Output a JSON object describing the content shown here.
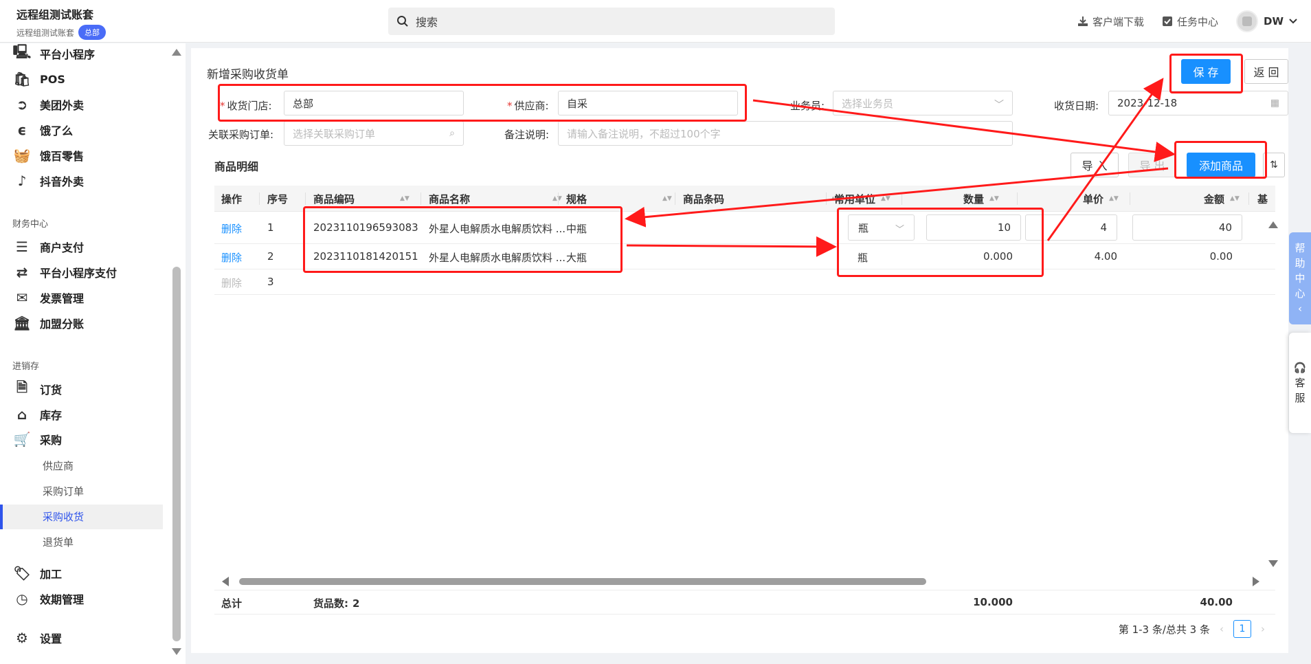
{
  "topbar": {
    "brand_title": "远程组测试账套",
    "brand_sub": "远程组测试账套",
    "brand_badge": "总部",
    "search_placeholder": "搜索",
    "download": "客户端下载",
    "tasks": "任务中心",
    "user": "DW"
  },
  "sidebar": {
    "items_top": [
      {
        "label": "平台小程序",
        "icon": "monitor-icon"
      },
      {
        "label": "POS",
        "icon": "shopping-bag-icon"
      },
      {
        "label": "美团外卖",
        "icon": "meituan-icon"
      },
      {
        "label": "饿了么",
        "icon": "eleme-icon"
      },
      {
        "label": "饿百零售",
        "icon": "basket-icon"
      },
      {
        "label": "抖音外卖",
        "icon": "tiktok-icon"
      }
    ],
    "group_finance": "财务中心",
    "items_finance": [
      {
        "label": "商户支付",
        "icon": "list-icon"
      },
      {
        "label": "平台小程序支付",
        "icon": "transfer-icon"
      },
      {
        "label": "发票管理",
        "icon": "invoice-icon"
      },
      {
        "label": "加盟分账",
        "icon": "bank-icon"
      }
    ],
    "group_inventory": "进销存",
    "items_inventory": [
      {
        "label": "订货",
        "icon": "document-icon"
      },
      {
        "label": "库存",
        "icon": "warehouse-icon"
      },
      {
        "label": "采购",
        "icon": "cart-icon"
      }
    ],
    "purchase_sub": [
      "供应商",
      "采购订单",
      "采购收货",
      "退货单"
    ],
    "items_bottom": [
      {
        "label": "加工",
        "icon": "tag-icon"
      },
      {
        "label": "效期管理",
        "icon": "clock-icon"
      }
    ],
    "settings": "设置"
  },
  "form": {
    "title": "新增采购收货单",
    "save": "保 存",
    "back": "返 回",
    "store_label": "收货门店:",
    "store_value": "总部",
    "supplier_label": "供应商:",
    "supplier_value": "自采",
    "salesman_label": "业务员:",
    "salesman_placeholder": "选择业务员",
    "date_label": "收货日期:",
    "date_value": "2023-12-18",
    "order_label": "关联采购订单:",
    "order_placeholder": "选择关联采购订单",
    "remark_label": "备注说明:",
    "remark_placeholder": "请输入备注说明，不超过100个字"
  },
  "details": {
    "title": "商品明细",
    "import": "导 入",
    "export": "导 出",
    "add": "添加商品",
    "columns": [
      "操作",
      "序号",
      "商品编码",
      "商品名称",
      "规格",
      "商品条码",
      "常用单位",
      "数量",
      "单价",
      "金额",
      "基"
    ],
    "rows": [
      {
        "action": "删除",
        "no": "1",
        "code": "2023110196593083",
        "name": "外星人电解质水电解质饮料 ...",
        "spec": "中瓶",
        "barcode": "",
        "unit": "瓶",
        "qty": "10",
        "price": "4",
        "amount": "40"
      },
      {
        "action": "删除",
        "no": "2",
        "code": "2023110181420151",
        "name": "外星人电解质水电解质饮料 ...",
        "spec": "大瓶",
        "barcode": "",
        "unit": "瓶",
        "qty": "0.000",
        "price": "4.00",
        "amount": "0.00"
      },
      {
        "action": "删除",
        "no": "3"
      }
    ],
    "total_label": "总计",
    "count_label": "货品数:",
    "count_value": "2",
    "total_qty": "10.000",
    "total_amount": "40.00",
    "pager_text": "第 1-3 条/总共 3 条",
    "page": "1"
  },
  "floating": {
    "help": [
      "帮",
      "助",
      "中",
      "心",
      "‹"
    ],
    "service": [
      "客",
      "服"
    ]
  },
  "colors": {
    "primary": "#1890ff",
    "annotation": "#ff1a1a",
    "sidebar_active": "#2f54eb"
  }
}
